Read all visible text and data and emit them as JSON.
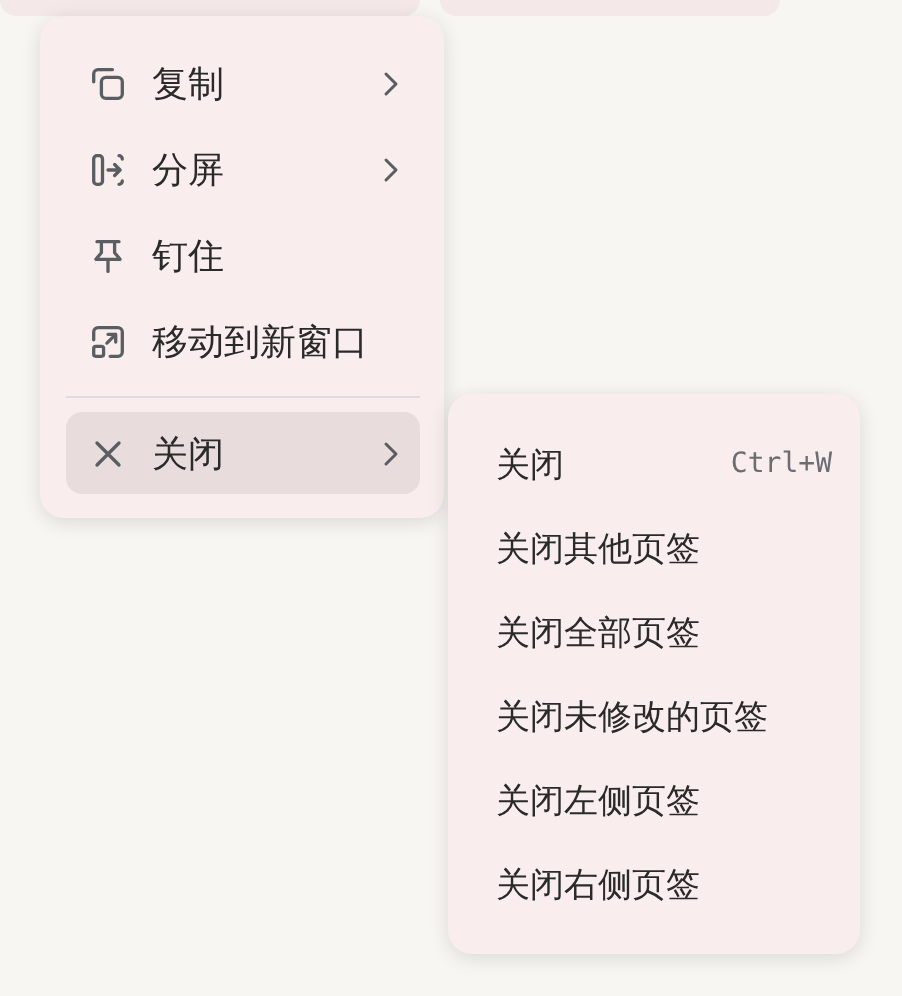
{
  "menu": {
    "items": [
      {
        "kind": "copy",
        "label": "复制",
        "submenu": true,
        "selected": false
      },
      {
        "kind": "split",
        "label": "分屏",
        "submenu": true,
        "selected": false
      },
      {
        "kind": "pin",
        "label": "钉住",
        "submenu": false,
        "selected": false
      },
      {
        "kind": "move",
        "label": "移动到新窗口",
        "submenu": false,
        "selected": false
      },
      {
        "kind": "divider"
      },
      {
        "kind": "close",
        "label": "关闭",
        "submenu": true,
        "selected": true
      }
    ]
  },
  "submenu": {
    "items": [
      {
        "label": "关闭",
        "shortcut": "Ctrl+W"
      },
      {
        "label": "关闭其他页签"
      },
      {
        "label": "关闭全部页签"
      },
      {
        "label": "关闭未修改的页签"
      },
      {
        "label": "关闭左侧页签"
      },
      {
        "label": "关闭右侧页签"
      }
    ]
  }
}
